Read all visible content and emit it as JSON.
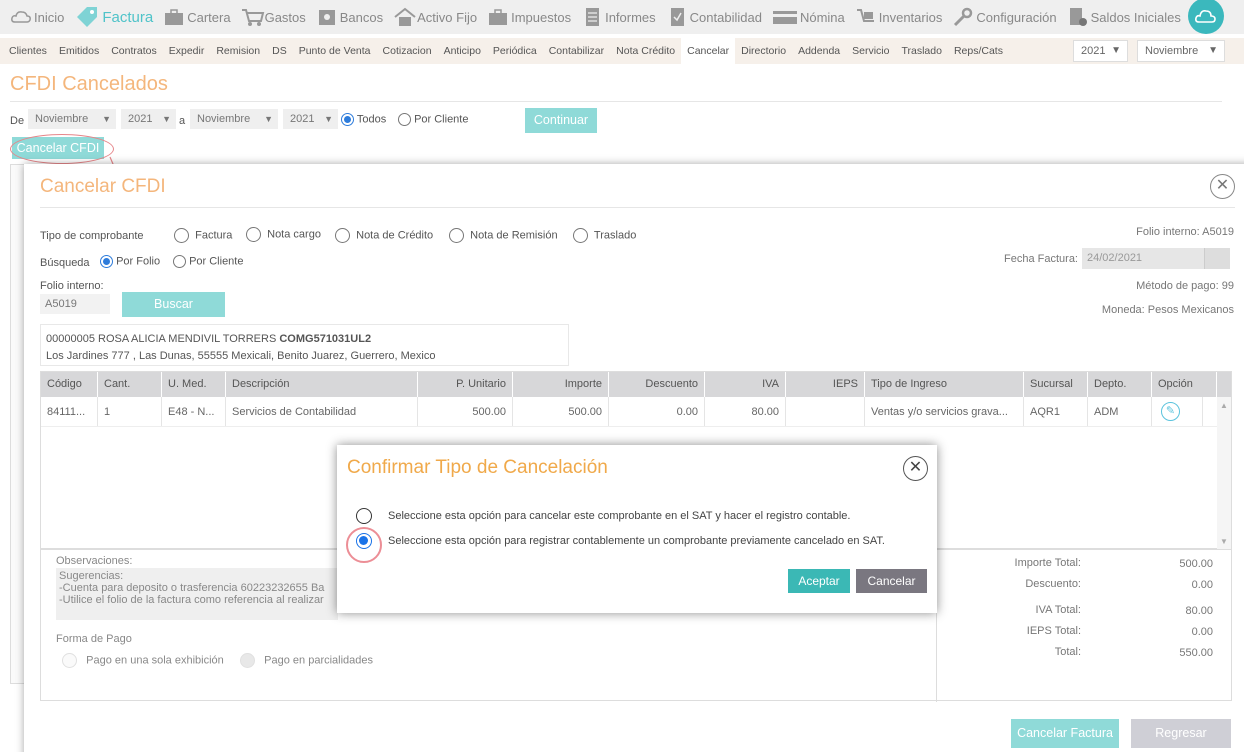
{
  "nav": {
    "items": [
      {
        "label": "Inicio",
        "icon": "cloud-icon"
      },
      {
        "label": "Factura",
        "icon": "tag-icon",
        "active": true
      },
      {
        "label": "Cartera",
        "icon": "briefcase-icon"
      },
      {
        "label": "Gastos",
        "icon": "cart-icon"
      },
      {
        "label": "Bancos",
        "icon": "safe-icon"
      },
      {
        "label": "Activo Fijo",
        "icon": "house-icon"
      },
      {
        "label": "Impuestos",
        "icon": "briefcase-icon"
      },
      {
        "label": "Informes",
        "icon": "document-icon"
      },
      {
        "label": "Contabilidad",
        "icon": "checklist-icon"
      },
      {
        "label": "Nómina",
        "icon": "card-icon"
      },
      {
        "label": "Inventarios",
        "icon": "box-icon"
      },
      {
        "label": "Configuración",
        "icon": "wrench-icon"
      },
      {
        "label": "Saldos Iniciales",
        "icon": "document-gear-icon"
      }
    ],
    "accent": "#4fc3c9"
  },
  "submenu": {
    "items": [
      "Clientes",
      "Emitidos",
      "Contratos",
      "Expedir",
      "Remision",
      "DS",
      "Punto de Venta",
      "Cotizacion",
      "Anticipo",
      "Periódica",
      "Contabilizar",
      "Nota Crédito",
      "Cancelar",
      "Directorio",
      "Addenda",
      "Servicio",
      "Traslado",
      "Reps/Cats"
    ],
    "active": "Cancelar",
    "year": "2021",
    "month": "Noviembre"
  },
  "page": {
    "title": "CFDI Cancelados",
    "de_label": "De",
    "from_month": "Noviembre",
    "from_year": "2021",
    "a_label": "a",
    "to_month": "Noviembre",
    "to_year": "2021",
    "todos_label": "Todos",
    "por_cliente_label": "Por Cliente",
    "continuar_label": "Continuar",
    "cancelar_cfdi_label": "Cancelar CFDI"
  },
  "modal": {
    "title": "Cancelar CFDI",
    "tipo_label": "Tipo de comprobante",
    "tipos": [
      "Factura",
      "Nota cargo",
      "Nota de Crédito",
      "Nota de Remisión",
      "Traslado"
    ],
    "busqueda_label": "Búsqueda",
    "por_folio_label": "Por Folio",
    "por_cliente_label": "Por Cliente",
    "folio_label": "Folio interno:",
    "folio_value": "A5019",
    "buscar_label": "Buscar",
    "folio_interno_info": "Folio interno: A5019",
    "fecha_label": "Fecha Factura:",
    "fecha_value": "24/02/2021",
    "metodo_pago": "Método de pago: 99",
    "moneda": "Moneda: Pesos Mexicanos",
    "client_line1_prefix": "00000005 ROSA ALICIA MENDIVIL TORRERS ",
    "client_rfc": "COMG571031UL2",
    "client_line2": "Los Jardines 777 , Las Dunas, 55555 Mexicali, Benito Juarez, Guerrero, Mexico",
    "columns": [
      "Código",
      "Cant.",
      "U. Med.",
      "Descripción",
      "P. Unitario",
      "Importe",
      "Descuento",
      "IVA",
      "IEPS",
      "Tipo de Ingreso",
      "Sucursal",
      "Depto.",
      "Opción"
    ],
    "row": {
      "codigo": "84111...",
      "cant": "1",
      "umed": "E48 - N...",
      "descripcion": "Servicios de Contabilidad",
      "punitario": "500.00",
      "importe": "500.00",
      "descuento": "0.00",
      "iva": "80.00",
      "ieps": "",
      "tipo_ingreso": "Ventas y/o servicios grava...",
      "sucursal": "AQR1",
      "depto": "ADM"
    },
    "observaciones_label": "Observaciones:",
    "observaciones_text": "Sugerencias:\n-Cuenta para deposito o trasferencia 60223232655 Ba\n-Utilice el folio de la factura como referencia al realizar",
    "forma_pago_label": "Forma de Pago",
    "pago_unico_label": "Pago en una sola exhibición",
    "pago_parc_label": "Pago en parcialidades",
    "totals": [
      {
        "label": "Importe Total:",
        "value": "500.00"
      },
      {
        "label": "Descuento:",
        "value": "0.00"
      },
      {
        "label": "IVA Total:",
        "value": "80.00"
      },
      {
        "label": "IEPS Total:",
        "value": "0.00"
      },
      {
        "label": "Total:",
        "value": "550.00"
      }
    ],
    "cancelar_factura_label": "Cancelar Factura",
    "regresar_label": "Regresar"
  },
  "confirm": {
    "title": "Confirmar Tipo de Cancelación",
    "option1": "Seleccione esta opción para cancelar este comprobante en el SAT y hacer el registro contable.",
    "option2": "Seleccione esta opción para registrar contablemente un comprobante previamente cancelado en SAT.",
    "aceptar_label": "Aceptar",
    "cancelar_label": "Cancelar"
  },
  "colors": {
    "teal": "#8fdad8",
    "orange_title": "#f4b67c",
    "confirm_title": "#f0a94a",
    "highlight": "#e6868a"
  }
}
